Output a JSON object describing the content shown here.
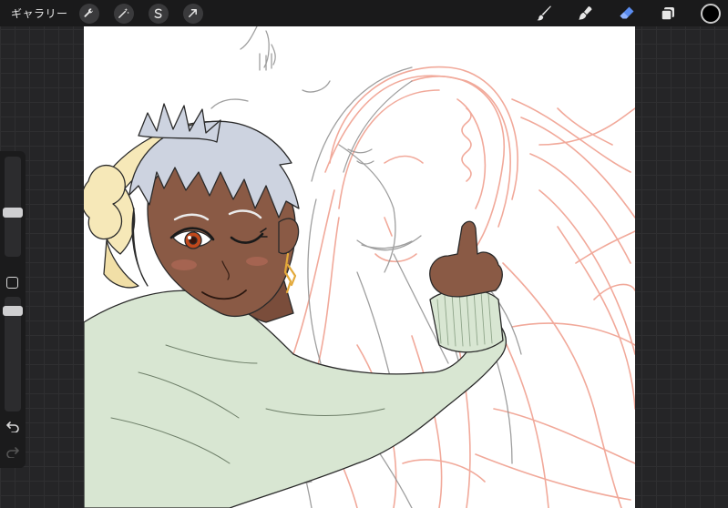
{
  "topbar": {
    "gallery_label": "ギャラリー",
    "left_tools": [
      "wrench-icon",
      "magic-wand-icon",
      "selection-icon",
      "transform-arrow-icon"
    ],
    "right_tools": [
      "brush-icon",
      "smudge-icon",
      "eraser-icon",
      "layers-icon"
    ],
    "active_tool": "eraser-icon",
    "current_color": "#000000",
    "eraser_color": "#5a8cf0"
  },
  "sidebar": {
    "size_slider": 0.55,
    "opacity_slider": 0.2,
    "icons": [
      "modify-square-icon",
      "undo-icon",
      "redo-icon"
    ]
  },
  "canvas": {
    "background": "#ffffff",
    "sketch_colors": [
      "#f0a090",
      "#9a9a9a"
    ],
    "character_colors": {
      "hair": "#cdd3e0",
      "headband": "#f6e8b8",
      "skin": "#8a5a45",
      "sweater": "#d8e6d2",
      "eye": "#c0481c"
    }
  }
}
